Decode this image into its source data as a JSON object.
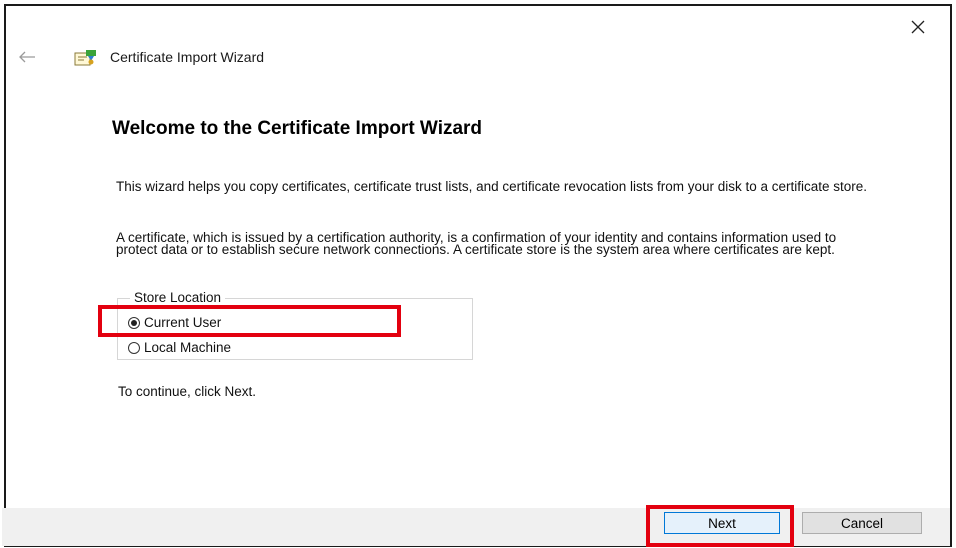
{
  "window": {
    "title": "Certificate Import Wizard",
    "close_icon": "close-icon",
    "back_icon": "back-arrow-icon",
    "title_icon": "certificate-icon"
  },
  "content": {
    "heading": "Welcome to the Certificate Import Wizard",
    "paragraph1": "This wizard helps you copy certificates, certificate trust lists, and certificate revocation lists from your disk to a certificate store.",
    "paragraph2": "A certificate, which is issued by a certification authority, is a confirmation of your identity and contains information used to protect data or to establish secure network connections. A certificate store is the system area where certificates are kept.",
    "store_location": {
      "label": "Store Location",
      "options": [
        {
          "label": "Current User",
          "selected": true
        },
        {
          "label": "Local Machine",
          "selected": false
        }
      ]
    },
    "continue_text": "To continue, click Next."
  },
  "footer": {
    "next_label": "Next",
    "cancel_label": "Cancel"
  },
  "colors": {
    "highlight": "#e3000f",
    "footer_bg": "#f0f0f0",
    "default_button_border": "#0078d7"
  }
}
